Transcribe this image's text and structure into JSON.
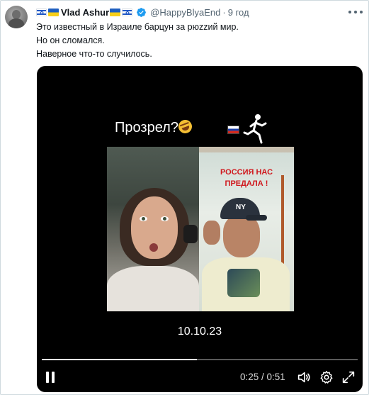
{
  "tweet": {
    "author": {
      "name": "Vlad Ashur",
      "handle": "@HappyBlyaEnd",
      "verified": true,
      "name_flags_before": [
        "israel-flag",
        "ukraine-flag"
      ],
      "name_flags_after": [
        "ukraine-flag",
        "israel-flag"
      ]
    },
    "separator": "·",
    "time": "9 год",
    "text_lines": [
      "Это известный в Израиле барцун за рюzzий мир.",
      "Но он сломался.",
      "Наверное что-то случилось."
    ],
    "more_icon": "more-horizontal-icon"
  },
  "video": {
    "caption": "Прозрел?",
    "caption_emoji": "rolling-on-floor-laughing-emoji",
    "caption_flag": "russia-flag",
    "caption_figure": "running-man-icon",
    "right_panel_banner_lines": [
      "РОССИЯ НАС",
      "ПРЕДАЛА !"
    ],
    "cap_logo": "NY",
    "date": "10.10.23",
    "progress_fraction": 0.49,
    "timecode": "0:25 / 0:51",
    "controls": {
      "pause_icon": "pause-icon",
      "volume_icon": "volume-icon",
      "settings_icon": "gear-icon",
      "fullscreen_icon": "expand-icon"
    }
  },
  "colors": {
    "text": "#0f1419",
    "secondary_text": "#536471",
    "verified_blue": "#1d9bf0",
    "video_bg": "#000000",
    "banner_red": "#d0171c"
  }
}
